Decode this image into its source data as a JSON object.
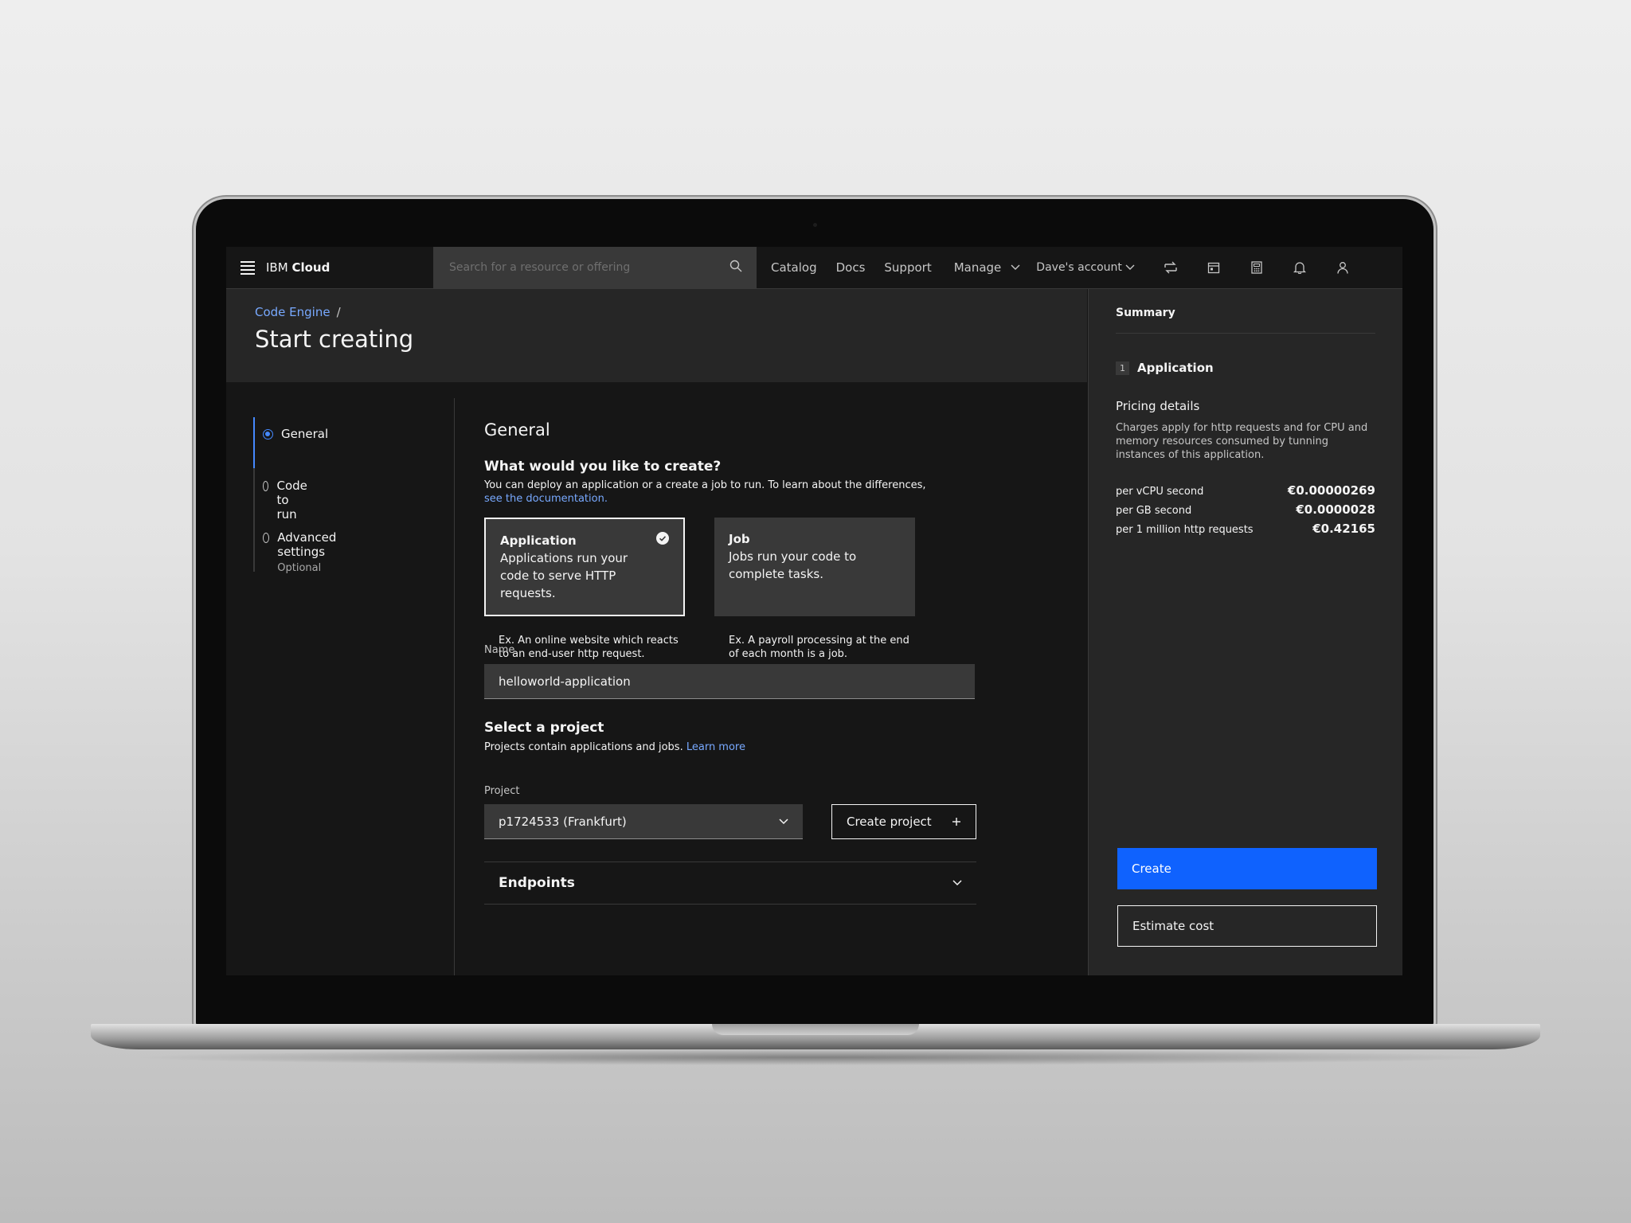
{
  "header": {
    "brand_prefix": "IBM",
    "brand_name": "Cloud",
    "search_placeholder": "Search for a resource or offering",
    "nav": [
      "Catalog",
      "Docs",
      "Support",
      "Manage"
    ],
    "account": "Dave's account",
    "icons": [
      "switcher-icon",
      "calendar-icon",
      "calculator-icon",
      "notification-icon",
      "user-icon"
    ]
  },
  "page": {
    "breadcrumb": "Code Engine",
    "breadcrumb_sep": "/",
    "title": "Start creating"
  },
  "progress": {
    "steps": [
      {
        "label": "General",
        "sub": "",
        "state": "current"
      },
      {
        "label": "Code to run",
        "sub": "",
        "state": "incomplete"
      },
      {
        "label": "Advanced settings",
        "sub": "Optional",
        "state": "incomplete"
      }
    ]
  },
  "form": {
    "section_title": "General",
    "question": "What would you like to create?",
    "question_desc": "You can deploy an application or a create a job to run. To learn about the differences,",
    "question_link": "see the documentation.",
    "tiles": [
      {
        "title": "Application",
        "desc": "Applications run your code to serve HTTP requests.",
        "example": "Ex. An online website which reacts to an end-user http request.",
        "selected": true
      },
      {
        "title": "Job",
        "desc": "Jobs run your code to complete tasks.",
        "example": "Ex. A payroll processing at the end of each month is a job.",
        "selected": false
      }
    ],
    "name_label": "Name",
    "name_value": "helloworld-application",
    "project_title": "Select a project",
    "project_desc": "Projects contain applications and jobs.",
    "project_link": "Learn more",
    "project_label": "Project",
    "project_value": "p1724533 (Frankfurt)",
    "create_project_label": "Create project",
    "accordion_label": "Endpoints"
  },
  "summary": {
    "title": "Summary",
    "step_number": "1",
    "item": "Application",
    "pricing_title": "Pricing details",
    "pricing_desc": "Charges apply for http requests and for CPU and memory resources consumed by tunning instances of this application.",
    "prices": [
      {
        "label": "per vCPU second",
        "value": "€0.00000269"
      },
      {
        "label": "per GB second",
        "value": "€0.0000028"
      },
      {
        "label": "per 1 million http requests",
        "value": "€0.42165"
      }
    ],
    "create_label": "Create",
    "estimate_label": "Estimate cost"
  },
  "colors": {
    "accent": "#0f62fe",
    "link": "#78a9ff",
    "background": "#161616",
    "layer": "#262626",
    "field": "#393939"
  }
}
